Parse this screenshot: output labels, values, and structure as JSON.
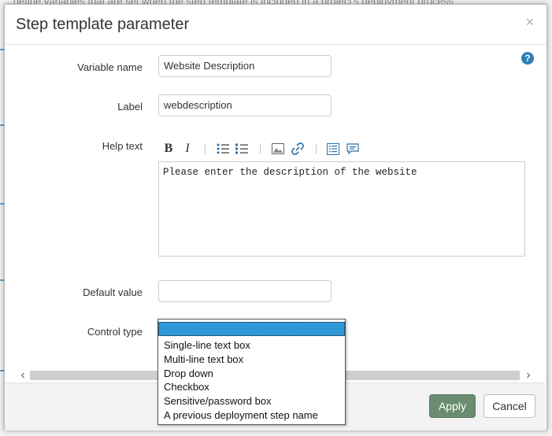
{
  "background": {
    "top_text": "...define variables that are set when the step template is included in a project's deployment process"
  },
  "dialog": {
    "title": "Step template parameter",
    "close_glyph": "×",
    "help_glyph": "?"
  },
  "fields": {
    "variable_name": {
      "label": "Variable name",
      "value": "Website Description"
    },
    "label": {
      "label": "Label",
      "value": "webdescription"
    },
    "help_text": {
      "label": "Help text",
      "value": "Please enter the description of the website"
    },
    "default_value": {
      "label": "Default value",
      "value": ""
    },
    "control_type": {
      "label": "Control type"
    }
  },
  "toolbar": {
    "bold": "B",
    "italic": "I"
  },
  "control_type_options": [
    "",
    "Single-line text box",
    "Multi-line text box",
    "Drop down",
    "Checkbox",
    "Sensitive/password box",
    "A previous deployment step name"
  ],
  "footer": {
    "apply": "Apply",
    "cancel": "Cancel"
  },
  "colors": {
    "accent": "#2c7fb3",
    "apply_button": "#6b8c71",
    "selected_option": "#2e99d8"
  }
}
